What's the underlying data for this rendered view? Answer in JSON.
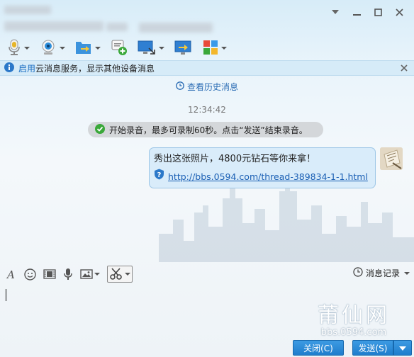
{
  "title_bar": {
    "controls": [
      "chevron-down-icon",
      "minimize-icon",
      "maximize-icon",
      "close-icon"
    ]
  },
  "toolbar": {
    "items": [
      {
        "name": "voice-call",
        "icon": "microphone-icon"
      },
      {
        "name": "video-call",
        "icon": "webcam-icon"
      },
      {
        "name": "send-file",
        "icon": "file-transfer-icon"
      },
      {
        "name": "create-group",
        "icon": "group-chat-icon"
      },
      {
        "name": "remote-desktop",
        "icon": "monitor-icon"
      },
      {
        "name": "share-screen",
        "icon": "screen-share-icon"
      },
      {
        "name": "apps",
        "icon": "apps-grid-icon"
      }
    ]
  },
  "notice": {
    "link_text": "启用",
    "text": "云消息服务，显示其他设备消息"
  },
  "chat": {
    "history_link": "查看历史消息",
    "timestamp": "12:34:42",
    "system_message": "开始录音，最多可录制60秒。点击“发送”结束录音。",
    "message": {
      "text": "秀出这张照片，4800元钻石等你来拿！",
      "link": "http://bbs.0594.com/thread-389834-1-1.html"
    }
  },
  "input_toolbar": {
    "items": [
      "font-icon",
      "emoji-icon",
      "video-clip-icon",
      "voice-message-icon",
      "image-icon",
      "screenshot-icon"
    ],
    "history_label": "消息记录"
  },
  "watermark": {
    "big": "莆仙网",
    "small": "bbs.0594.com"
  },
  "buttons": {
    "close_label": "关闭(C)",
    "send_label": "发送(S)"
  },
  "colors": {
    "accent": "#1f7dcc",
    "notice_bg": "#d6ebf8",
    "bubble_bg": "#d9ecfa",
    "link": "#1a5fb4"
  }
}
